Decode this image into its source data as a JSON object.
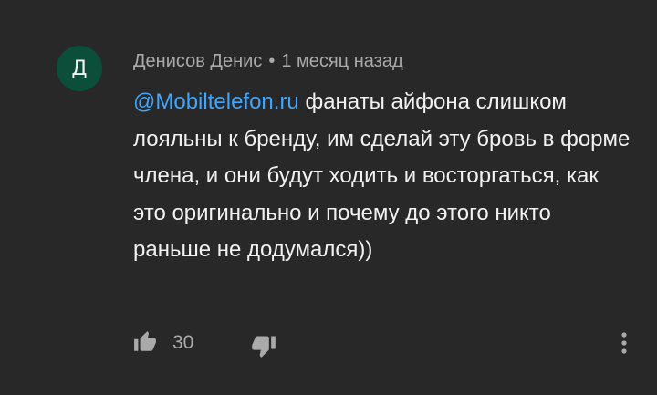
{
  "comment": {
    "avatar_letter": "Д",
    "avatar_color": "#0b4f3a",
    "author": "Денисов Денис",
    "separator": "•",
    "time": "1 месяц назад",
    "mention": "@Mobiltelefon.ru",
    "text": "фанаты айфона слишком лояльны к бренду, им сделай эту бровь в форме члена, и они будут ходить и восторгаться, как это оригинально и почему до этого никто раньше не додумался))"
  },
  "actions": {
    "like_icon": "thumb-up-icon",
    "like_count": "30",
    "dislike_icon": "thumb-down-icon",
    "menu_icon": "more-vert-icon"
  },
  "colors": {
    "background": "#282828",
    "text": "#f1f1f1",
    "secondary_text": "#aaaaaa",
    "link": "#3ea6ff"
  }
}
